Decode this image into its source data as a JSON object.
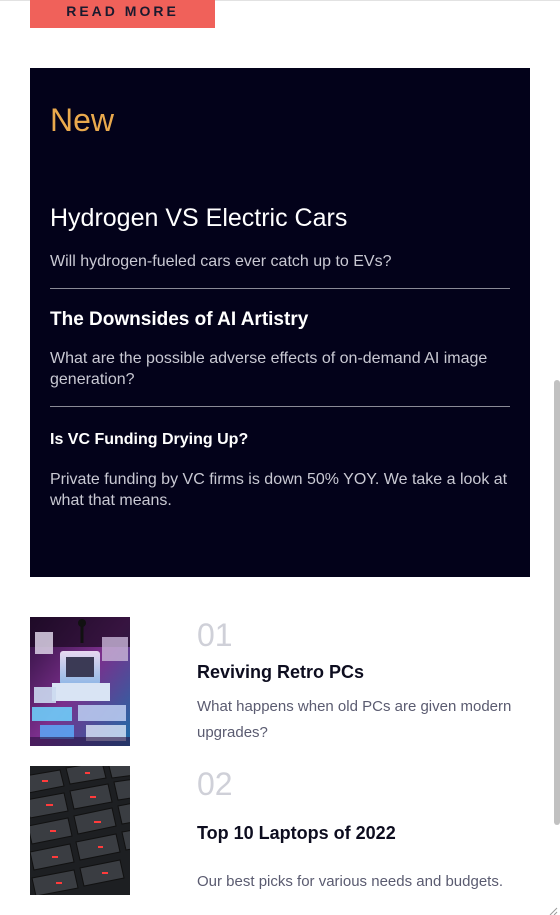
{
  "hero": {
    "read_more_label": "READ MORE"
  },
  "new_section": {
    "heading": "New",
    "articles": [
      {
        "title": "Hydrogen VS Electric Cars",
        "description": "Will hydrogen-fueled cars ever catch up to EVs?"
      },
      {
        "title": "The Downsides of AI Artistry",
        "description": "What are the possible adverse effects of on-demand AI image generation?"
      },
      {
        "title": "Is VC Funding Drying Up?",
        "description": "Private funding by VC firms is down 50% YOY. We take a look at what that means."
      }
    ]
  },
  "posts": [
    {
      "number": "01",
      "title": "Reviving Retro PCs",
      "description": "What happens when old PCs are given modern upgrades?"
    },
    {
      "number": "02",
      "title": "Top 10 Laptops of 2022",
      "description": "Our best picks for various needs and budgets."
    }
  ],
  "colors": {
    "accent_button": "#f0615a",
    "panel_background": "#03021a",
    "new_heading": "#e9a94d",
    "muted_number": "#cfd0d8"
  },
  "icons": [
    "resize-handle-icon"
  ]
}
